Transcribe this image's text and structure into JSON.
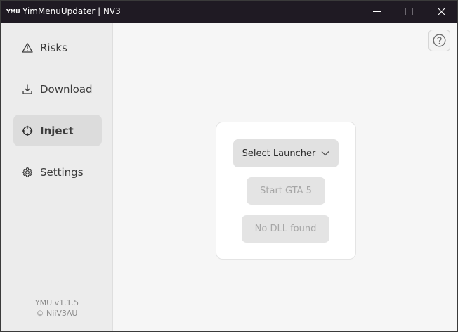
{
  "window": {
    "logo": "YMU",
    "title": "YimMenuUpdater | NV3"
  },
  "sidebar": {
    "items": [
      {
        "label": "Risks",
        "icon": "warning-icon",
        "active": false
      },
      {
        "label": "Download",
        "icon": "download-icon",
        "active": false
      },
      {
        "label": "Inject",
        "icon": "crosshair-icon",
        "active": true
      },
      {
        "label": "Settings",
        "icon": "gear-icon",
        "active": false
      }
    ],
    "version": "YMU v1.1.5",
    "copyright": "© NiiV3AU"
  },
  "main": {
    "launcher_select": "Select Launcher",
    "start_button": "Start GTA 5",
    "dll_button": "No DLL found"
  },
  "colors": {
    "titlebar": "#1f1a23",
    "sidebar": "#ececec",
    "active_item": "#dcdcdc",
    "content_bg": "#f6f6f6",
    "card": "#ffffff",
    "disabled_text": "#a6a6a6"
  }
}
